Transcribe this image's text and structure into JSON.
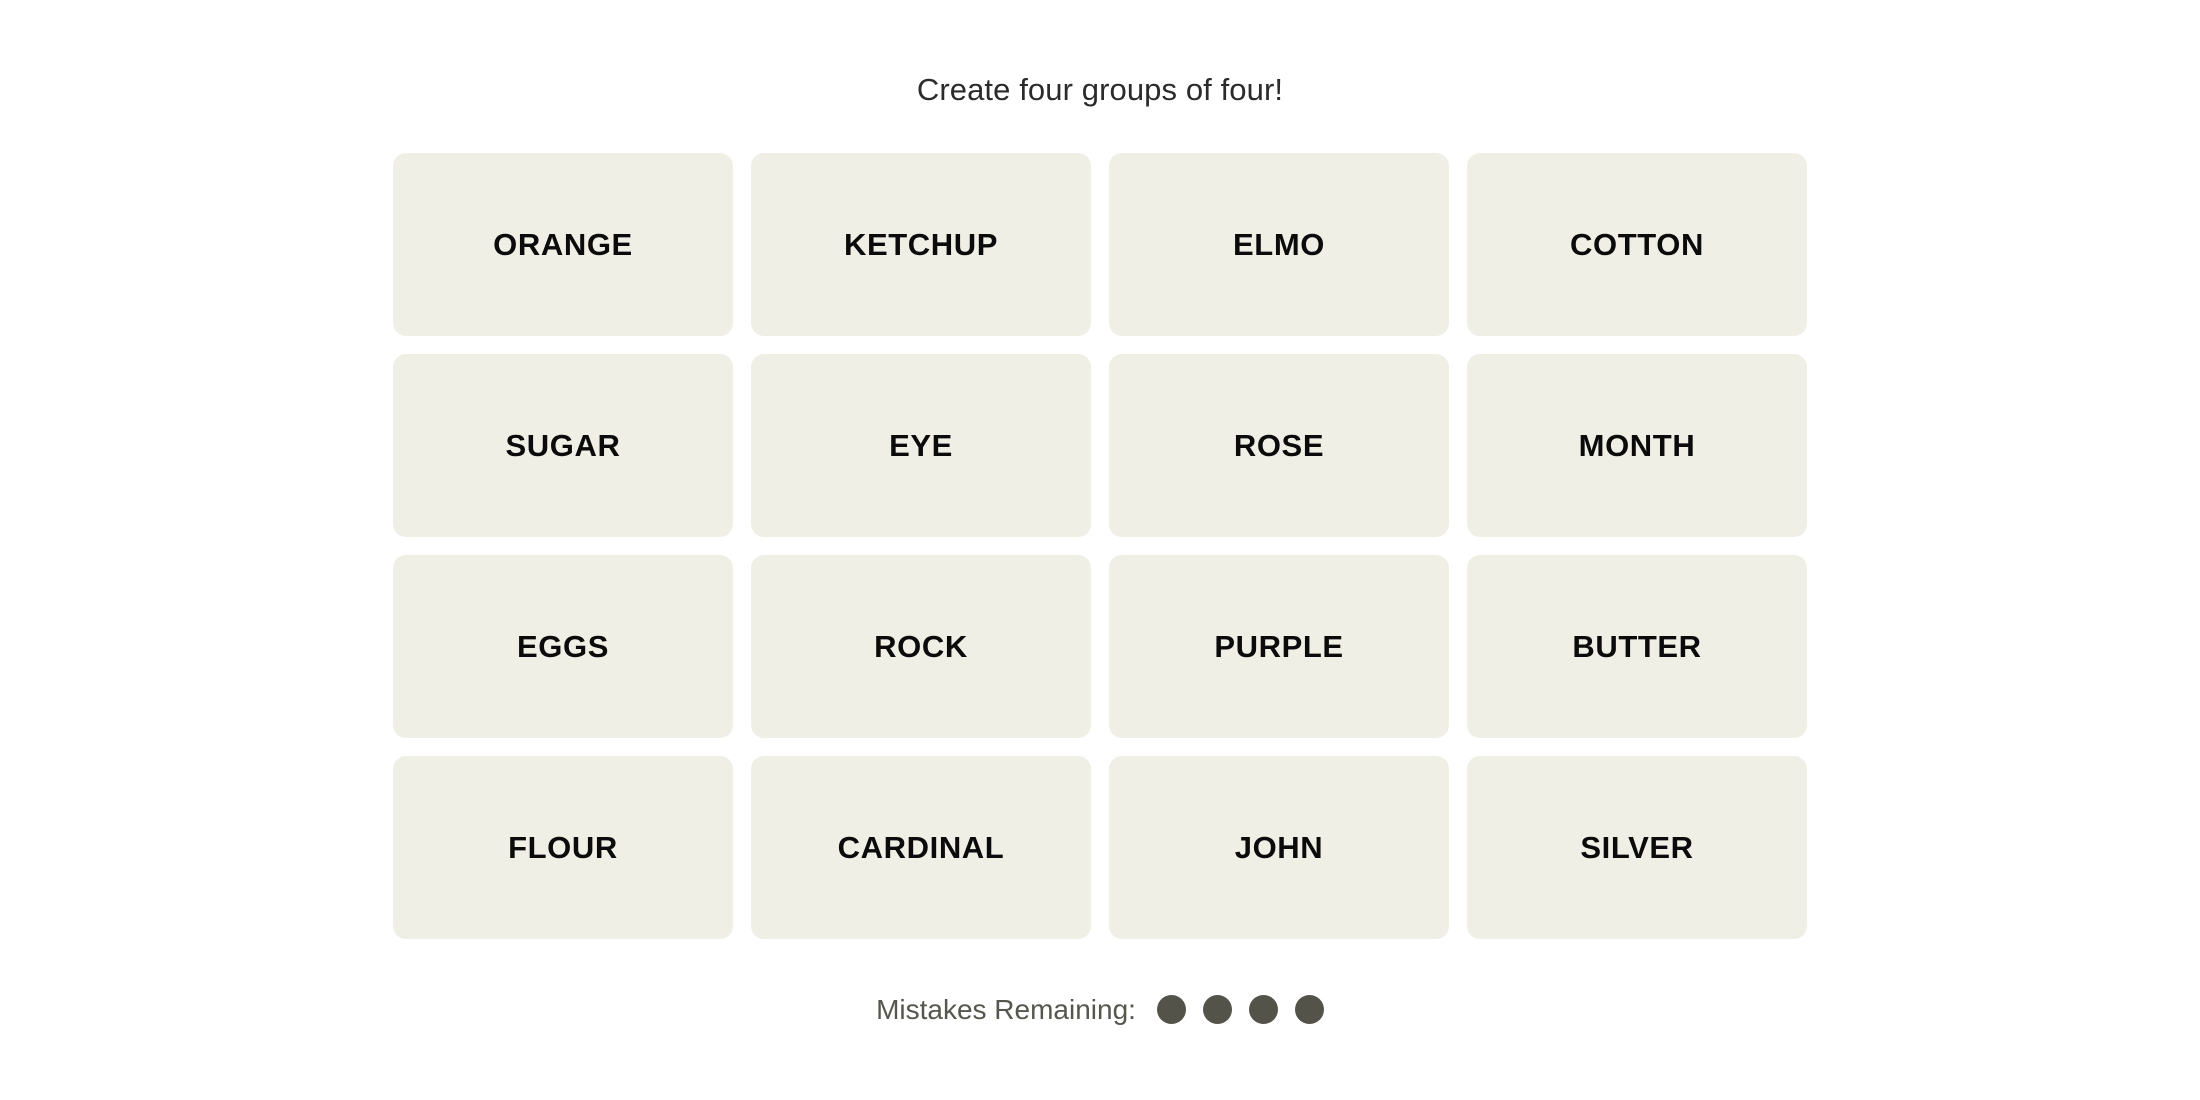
{
  "game": {
    "instructions": "Create four groups of four!",
    "tiles": [
      {
        "label": "ORANGE"
      },
      {
        "label": "KETCHUP"
      },
      {
        "label": "ELMO"
      },
      {
        "label": "COTTON"
      },
      {
        "label": "SUGAR"
      },
      {
        "label": "EYE"
      },
      {
        "label": "ROSE"
      },
      {
        "label": "MONTH"
      },
      {
        "label": "EGGS"
      },
      {
        "label": "ROCK"
      },
      {
        "label": "PURPLE"
      },
      {
        "label": "BUTTER"
      },
      {
        "label": "FLOUR"
      },
      {
        "label": "CARDINAL"
      },
      {
        "label": "JOHN"
      },
      {
        "label": "SILVER"
      }
    ],
    "mistakes": {
      "label": "Mistakes Remaining:",
      "remaining": 4,
      "dots": [
        1,
        2,
        3,
        4
      ]
    },
    "colors": {
      "background": "#ffffff",
      "tile_fill": "#efefe6",
      "tile_text": "#0b0b0b",
      "instructions_text": "#2b2b2b",
      "mistakes_text": "#56564f",
      "dot_fill": "#53534a"
    }
  }
}
